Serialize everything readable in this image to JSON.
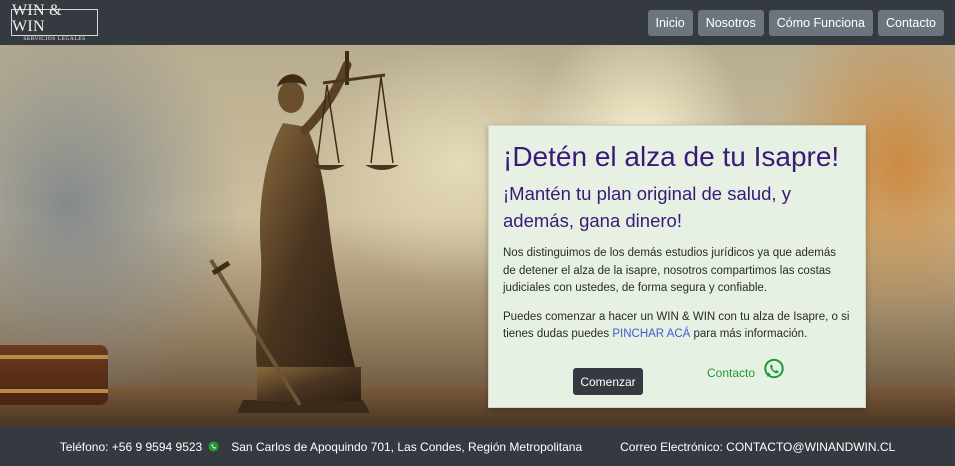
{
  "logo": {
    "main": "WIN & WIN",
    "sub": "SERVICIOS LEGALES"
  },
  "nav": {
    "items": [
      {
        "label": "Inicio"
      },
      {
        "label": "Nosotros"
      },
      {
        "label": "Cómo Funciona"
      },
      {
        "label": "Contacto"
      }
    ]
  },
  "hero": {
    "image_subject": "Lady Justice bronze statue on desk",
    "card": {
      "title": "¡Detén el alza de tu Isapre!",
      "subtitle": "¡Mantén tu plan original de salud, y además, gana dinero!",
      "paragraph1": "Nos distinguimos de los demás estudios jurídicos ya que además de detener el alza de la isapre, nosotros compartimos las costas judiciales con ustedes, de forma segura y confiable.",
      "paragraph2_before": "Puedes comenzar a hacer un WIN & WIN con tu alza de Isapre, o si tienes dudas puedes ",
      "paragraph2_link": "PINCHAR ACÁ",
      "paragraph2_after": " para más información.",
      "start_button": "Comenzar",
      "contact_link": "Contacto"
    }
  },
  "footer": {
    "phone": "Teléfono: +56 9 9594 9523",
    "address": "San Carlos de Apoquindo 701, Las Condes, Región Metropolitana",
    "email": "Correo Electrónico: CONTACTO@WINANDWIN.CL"
  },
  "icons": {
    "whatsapp": "whatsapp-icon"
  },
  "colors": {
    "navbar": "#343a40",
    "nav_button": "#6c757d",
    "card_bg": "#e6f1e4",
    "title": "#3a1a78",
    "link": "#3a5fcd",
    "whatsapp": "#1f9a3a"
  }
}
